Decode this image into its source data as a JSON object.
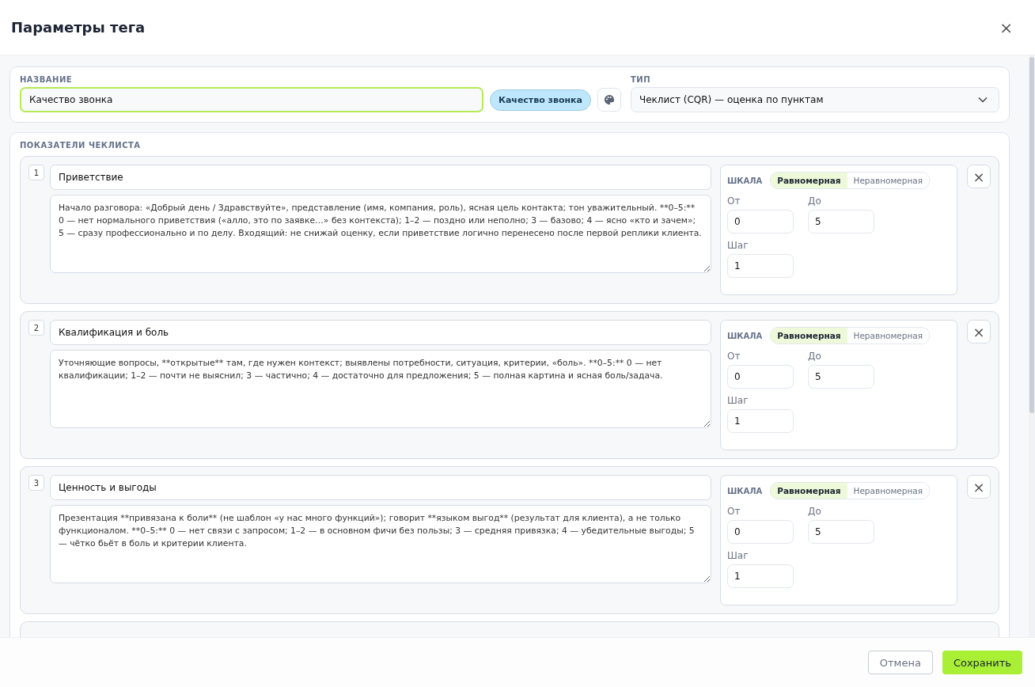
{
  "dialog": {
    "title": "Параметры тега",
    "close": "×"
  },
  "name_section": {
    "label": "НАЗВАНИЕ",
    "value": "Качество звонка",
    "tag_preview": "Качество звонка",
    "type_label": "ТИП",
    "type_value": "Чеклист (CQR) — оценка по пунктам"
  },
  "checklist": {
    "label": "ПОКАЗАТЕЛИ ЧЕКЛИСТА",
    "items": [
      {
        "number": "1",
        "title": "Приветствие",
        "description": "Начало разговора: «Добрый день / Здравствуйте», представление (имя, компания, роль), ясная цель контакта; тон уважительный. **0–5:** 0 — нет нормального приветствия («алло, это по заявке…» без контекста); 1–2 — поздно или неполно; 3 — базово; 4 — ясно «кто и зачем»; 5 — сразу профессионально и по делу. Входящий: не снижай оценку, если приветствие логично перенесено после первой реплики клиента.",
        "scale_label": "ШКАЛА",
        "scale_options": [
          {
            "label": "Равномерная",
            "selected": true
          },
          {
            "label": "Неравномерная",
            "selected": false
          }
        ],
        "from_label": "От",
        "from": "0",
        "to_label": "До",
        "to": "5",
        "step_label": "Шаг",
        "step": "1",
        "remove": "×"
      },
      {
        "number": "2",
        "title": "Квалификация и боль",
        "description": "Уточняющие вопросы, **открытые** там, где нужен контекст; выявлены потребности, ситуация, критерии, «боль». **0–5:** 0 — нет квалификации; 1–2 — почти не выяснил; 3 — частично; 4 — достаточно для предложения; 5 — полная картина и ясная боль/задача.",
        "scale_label": "ШКАЛА",
        "scale_options": [
          {
            "label": "Равномерная",
            "selected": true
          },
          {
            "label": "Неравномерная",
            "selected": false
          }
        ],
        "from_label": "От",
        "from": "0",
        "to_label": "До",
        "to": "5",
        "step_label": "Шаг",
        "step": "1",
        "remove": "×"
      },
      {
        "number": "3",
        "title": "Ценность и выгоды",
        "description": "Презентация **привязана к боли** (не шаблон «у нас много функций»); говорит **языком выгод** (результат для клиента), а не только функционалом. **0–5:** 0 — нет связи с запросом; 1–2 — в основном фичи без пользы; 3 — средняя привязка; 4 — убедительные выгоды; 5 — чётко бьёт в боль и критерии клиента.",
        "scale_label": "ШКАЛА",
        "scale_options": [
          {
            "label": "Равномерная",
            "selected": true
          },
          {
            "label": "Неравномерная",
            "selected": false
          }
        ],
        "from_label": "От",
        "from": "0",
        "to_label": "До",
        "to": "5",
        "step_label": "Шаг",
        "step": "1",
        "remove": "×"
      },
      {
        "kind": "partial"
      }
    ]
  },
  "footer": {
    "cancel": "Отмена",
    "save": "Сохранить"
  }
}
